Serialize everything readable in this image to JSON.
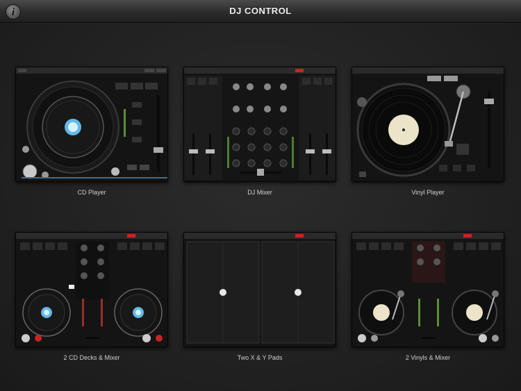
{
  "header": {
    "title": "DJ CONTROL",
    "info_icon": "info-icon",
    "info_glyph": "i"
  },
  "tiles": [
    {
      "label": "CD Player"
    },
    {
      "label": "DJ Mixer"
    },
    {
      "label": "Vinyl Player"
    },
    {
      "label": "2 CD Decks & Mixer"
    },
    {
      "label": "Two X & Y Pads"
    },
    {
      "label": "2 Vinyls & Mixer"
    }
  ],
  "colors": {
    "accent_blue": "#63b8e6",
    "led_green": "#7cc243",
    "led_red": "#d23b2e"
  }
}
